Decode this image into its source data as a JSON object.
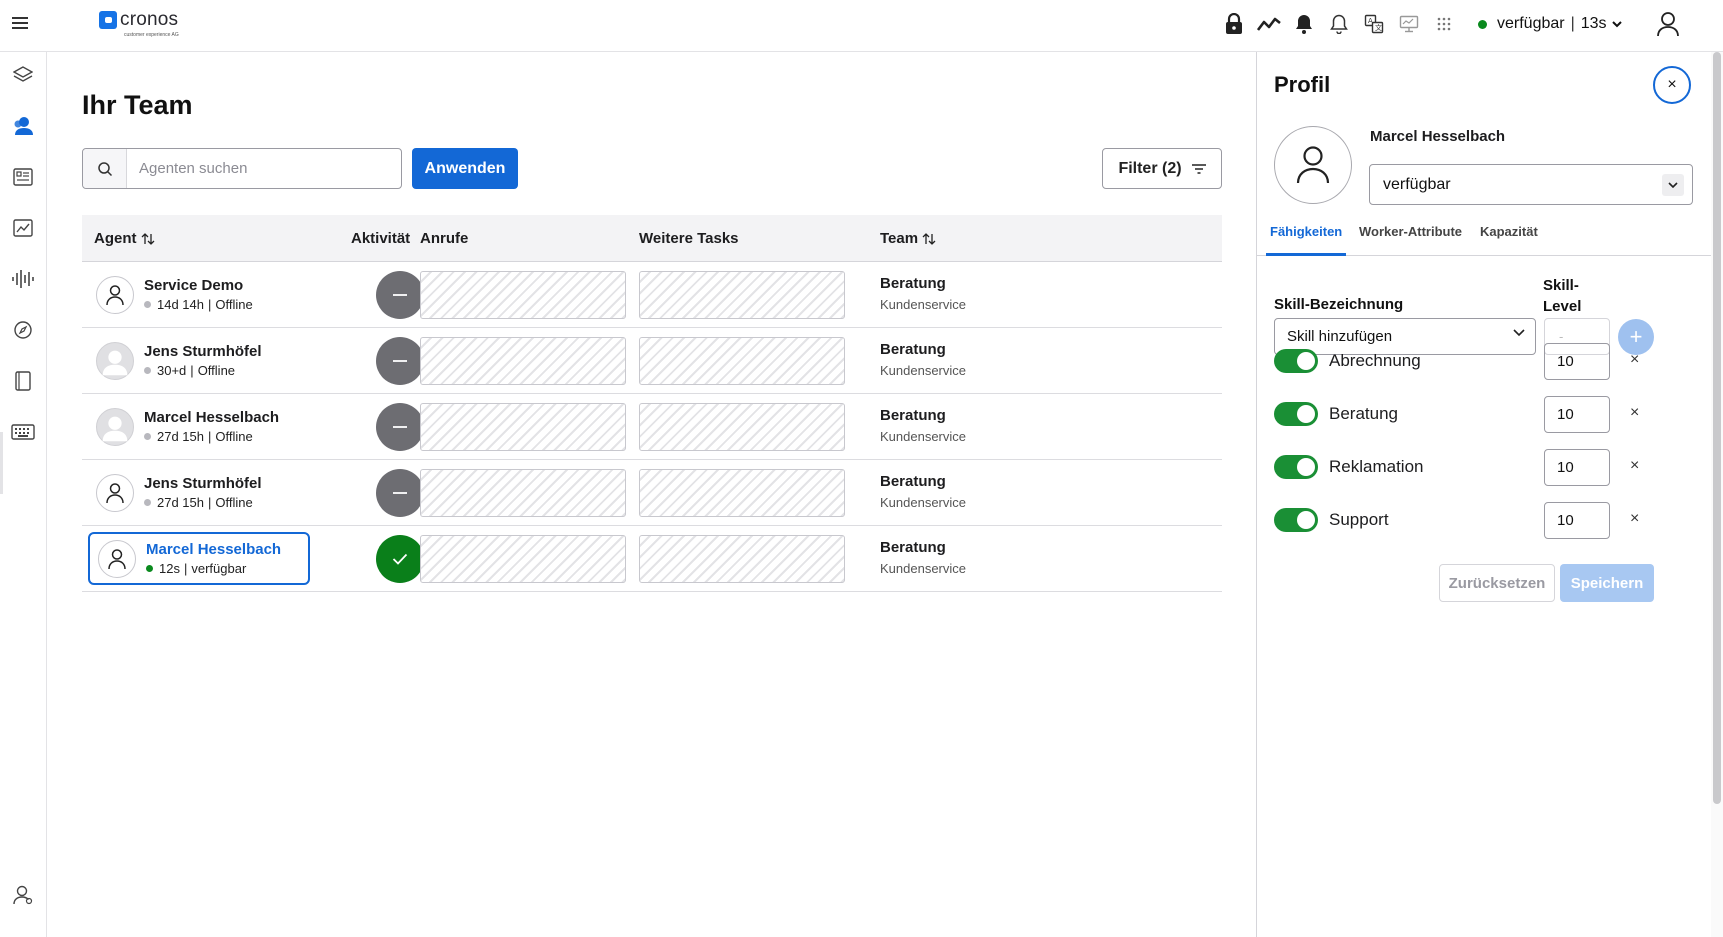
{
  "app": {
    "logo_text": "cronos",
    "logo_sub": "customer experience AG"
  },
  "topbar": {
    "icons": [
      "lock-icon",
      "activity-chart-icon",
      "notification-bell-filled-icon",
      "bell-icon",
      "translate-icon",
      "monitor-icon",
      "apps-grid-icon"
    ],
    "status": "verfügbar",
    "separator": "|",
    "duration": "13s",
    "status_color": "#0a8a1e"
  },
  "leftnav": {
    "items": [
      "layers-icon",
      "team-icon",
      "dashboard-icon",
      "analytics-icon",
      "voice-icon",
      "explore-icon",
      "book-icon",
      "keyboard-icon",
      "user-settings-icon"
    ]
  },
  "main": {
    "title": "Ihr Team",
    "search": {
      "placeholder": "Agenten suchen",
      "value": ""
    },
    "apply_label": "Anwenden",
    "filter_label": "Filter (2)",
    "columns": {
      "agent": "Agent",
      "activity": "Aktivität",
      "calls": "Anrufe",
      "tasks": "Weitere Tasks",
      "team": "Team"
    },
    "rows": [
      {
        "name": "Service Demo",
        "time": "14d 14h",
        "status": "Offline",
        "team": "Beratung",
        "team_sub": "Kundenservice",
        "active": false,
        "avatar": "outline"
      },
      {
        "name": "Jens Sturmhöfel",
        "time": "30+d",
        "status": "Offline",
        "team": "Beratung",
        "team_sub": "Kundenservice",
        "active": false,
        "avatar": "photo"
      },
      {
        "name": "Marcel Hesselbach",
        "time": "27d 15h",
        "status": "Offline",
        "team": "Beratung",
        "team_sub": "Kundenservice",
        "active": false,
        "avatar": "photo"
      },
      {
        "name": "Jens Sturmhöfel",
        "time": "27d 15h",
        "status": "Offline",
        "team": "Beratung",
        "team_sub": "Kundenservice",
        "active": false,
        "avatar": "outline"
      },
      {
        "name": "Marcel Hesselbach",
        "time": "12s",
        "status": "verfügbar",
        "team": "Beratung",
        "team_sub": "Kundenservice",
        "active": true,
        "avatar": "outline",
        "selected": true
      }
    ]
  },
  "panel": {
    "title": "Profil",
    "close": "×",
    "name": "Marcel Hesselbach",
    "status_select": "verfügbar",
    "tabs": [
      "Fähigkeiten",
      "Worker-Attribute",
      "Kapazität"
    ],
    "skill_col": "Skill-Bezeichnung",
    "level_col_1": "Skill-",
    "level_col_2": "Level",
    "skill_select": "Skill hinzufügen",
    "level_placeholder": "-",
    "add": "+",
    "skills": [
      {
        "label": "Abrechnung",
        "level": "10",
        "enabled": true
      },
      {
        "label": "Beratung",
        "level": "10",
        "enabled": true
      },
      {
        "label": "Reklamation",
        "level": "10",
        "enabled": true
      },
      {
        "label": "Support",
        "level": "10",
        "enabled": true
      }
    ],
    "remove": "×",
    "reset_label": "Zurücksetzen",
    "save_label": "Speichern"
  }
}
